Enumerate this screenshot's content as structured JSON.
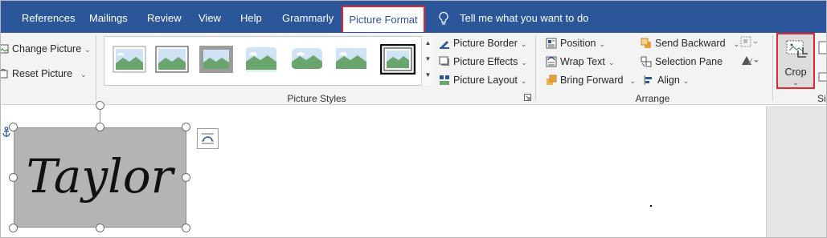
{
  "tabs": {
    "references": "References",
    "mailings": "Mailings",
    "review": "Review",
    "view": "View",
    "help": "Help",
    "grammarly": "Grammarly",
    "picture_format": "Picture Format"
  },
  "tell_me": "Tell me what you want to do",
  "adjust": {
    "change_picture": "Change Picture",
    "reset_picture": "Reset Picture"
  },
  "picture_styles": {
    "group_label": "Picture Styles",
    "picture_border": "Picture Border",
    "picture_effects": "Picture Effects",
    "picture_layout": "Picture Layout"
  },
  "arrange": {
    "group_label": "Arrange",
    "position": "Position",
    "wrap_text": "Wrap Text",
    "bring_forward": "Bring Forward",
    "send_backward": "Send Backward",
    "selection_pane": "Selection Pane",
    "align": "Align"
  },
  "size": {
    "crop": "Crop",
    "group_label_partial": "Si"
  },
  "document": {
    "signature_text": "Taylor"
  },
  "colors": {
    "ribbon_blue": "#2b579a",
    "highlight_red": "#e3262e",
    "ribbon_bg": "#f3f3f3"
  },
  "icons": [
    "lightbulb-icon",
    "change-picture-icon",
    "reset-picture-icon",
    "picture-border-icon",
    "picture-effects-icon",
    "picture-layout-icon",
    "position-icon",
    "wrap-text-icon",
    "bring-forward-icon",
    "send-backward-icon",
    "selection-pane-icon",
    "align-icon",
    "group-icon",
    "rotate-icon",
    "crop-icon",
    "anchor-icon",
    "layout-options-icon"
  ]
}
